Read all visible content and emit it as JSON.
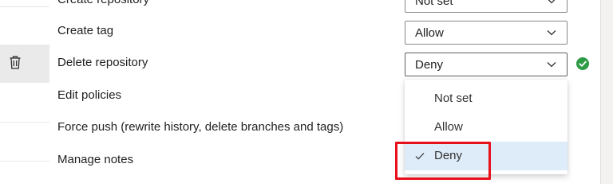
{
  "permissions": [
    {
      "label": "Create repository",
      "value": "Not set"
    },
    {
      "label": "Create tag",
      "value": "Allow"
    },
    {
      "label": "Delete repository",
      "value": "Deny"
    },
    {
      "label": "Edit policies",
      "value": ""
    },
    {
      "label": "Force push (rewrite history, delete branches and tags)",
      "value": ""
    },
    {
      "label": "Manage notes",
      "value": ""
    }
  ],
  "dropdown": {
    "options": [
      "Not set",
      "Allow",
      "Deny"
    ],
    "selected": "Deny"
  },
  "icons": {
    "row_icon": "trash-icon",
    "status": "check-circle-icon",
    "chevron": "chevron-down-icon",
    "selected_mark": "checkmark-icon"
  },
  "colors": {
    "status_green": "#2e9c45",
    "selected_bg": "#deecf9",
    "annotation_red": "#e8101a",
    "row_selected_bg": "#eaeaea"
  }
}
